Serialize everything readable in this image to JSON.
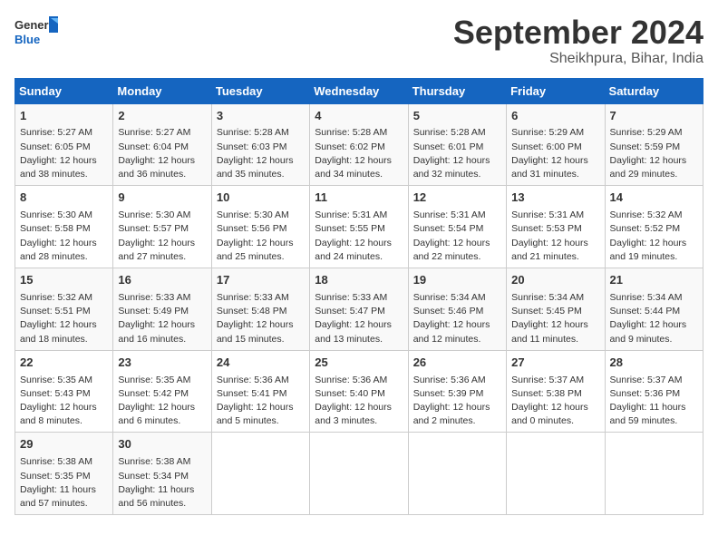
{
  "logo": {
    "line1": "General",
    "line2": "Blue"
  },
  "title": "September 2024",
  "location": "Sheikhpura, Bihar, India",
  "days_of_week": [
    "Sunday",
    "Monday",
    "Tuesday",
    "Wednesday",
    "Thursday",
    "Friday",
    "Saturday"
  ],
  "weeks": [
    [
      {
        "day": 1,
        "sunrise": "5:27 AM",
        "sunset": "6:05 PM",
        "daylight": "12 hours and 38 minutes."
      },
      {
        "day": 2,
        "sunrise": "5:27 AM",
        "sunset": "6:04 PM",
        "daylight": "12 hours and 36 minutes."
      },
      {
        "day": 3,
        "sunrise": "5:28 AM",
        "sunset": "6:03 PM",
        "daylight": "12 hours and 35 minutes."
      },
      {
        "day": 4,
        "sunrise": "5:28 AM",
        "sunset": "6:02 PM",
        "daylight": "12 hours and 34 minutes."
      },
      {
        "day": 5,
        "sunrise": "5:28 AM",
        "sunset": "6:01 PM",
        "daylight": "12 hours and 32 minutes."
      },
      {
        "day": 6,
        "sunrise": "5:29 AM",
        "sunset": "6:00 PM",
        "daylight": "12 hours and 31 minutes."
      },
      {
        "day": 7,
        "sunrise": "5:29 AM",
        "sunset": "5:59 PM",
        "daylight": "12 hours and 29 minutes."
      }
    ],
    [
      {
        "day": 8,
        "sunrise": "5:30 AM",
        "sunset": "5:58 PM",
        "daylight": "12 hours and 28 minutes."
      },
      {
        "day": 9,
        "sunrise": "5:30 AM",
        "sunset": "5:57 PM",
        "daylight": "12 hours and 27 minutes."
      },
      {
        "day": 10,
        "sunrise": "5:30 AM",
        "sunset": "5:56 PM",
        "daylight": "12 hours and 25 minutes."
      },
      {
        "day": 11,
        "sunrise": "5:31 AM",
        "sunset": "5:55 PM",
        "daylight": "12 hours and 24 minutes."
      },
      {
        "day": 12,
        "sunrise": "5:31 AM",
        "sunset": "5:54 PM",
        "daylight": "12 hours and 22 minutes."
      },
      {
        "day": 13,
        "sunrise": "5:31 AM",
        "sunset": "5:53 PM",
        "daylight": "12 hours and 21 minutes."
      },
      {
        "day": 14,
        "sunrise": "5:32 AM",
        "sunset": "5:52 PM",
        "daylight": "12 hours and 19 minutes."
      }
    ],
    [
      {
        "day": 15,
        "sunrise": "5:32 AM",
        "sunset": "5:51 PM",
        "daylight": "12 hours and 18 minutes."
      },
      {
        "day": 16,
        "sunrise": "5:33 AM",
        "sunset": "5:49 PM",
        "daylight": "12 hours and 16 minutes."
      },
      {
        "day": 17,
        "sunrise": "5:33 AM",
        "sunset": "5:48 PM",
        "daylight": "12 hours and 15 minutes."
      },
      {
        "day": 18,
        "sunrise": "5:33 AM",
        "sunset": "5:47 PM",
        "daylight": "12 hours and 13 minutes."
      },
      {
        "day": 19,
        "sunrise": "5:34 AM",
        "sunset": "5:46 PM",
        "daylight": "12 hours and 12 minutes."
      },
      {
        "day": 20,
        "sunrise": "5:34 AM",
        "sunset": "5:45 PM",
        "daylight": "12 hours and 11 minutes."
      },
      {
        "day": 21,
        "sunrise": "5:34 AM",
        "sunset": "5:44 PM",
        "daylight": "12 hours and 9 minutes."
      }
    ],
    [
      {
        "day": 22,
        "sunrise": "5:35 AM",
        "sunset": "5:43 PM",
        "daylight": "12 hours and 8 minutes."
      },
      {
        "day": 23,
        "sunrise": "5:35 AM",
        "sunset": "5:42 PM",
        "daylight": "12 hours and 6 minutes."
      },
      {
        "day": 24,
        "sunrise": "5:36 AM",
        "sunset": "5:41 PM",
        "daylight": "12 hours and 5 minutes."
      },
      {
        "day": 25,
        "sunrise": "5:36 AM",
        "sunset": "5:40 PM",
        "daylight": "12 hours and 3 minutes."
      },
      {
        "day": 26,
        "sunrise": "5:36 AM",
        "sunset": "5:39 PM",
        "daylight": "12 hours and 2 minutes."
      },
      {
        "day": 27,
        "sunrise": "5:37 AM",
        "sunset": "5:38 PM",
        "daylight": "12 hours and 0 minutes."
      },
      {
        "day": 28,
        "sunrise": "5:37 AM",
        "sunset": "5:36 PM",
        "daylight": "11 hours and 59 minutes."
      }
    ],
    [
      {
        "day": 29,
        "sunrise": "5:38 AM",
        "sunset": "5:35 PM",
        "daylight": "11 hours and 57 minutes."
      },
      {
        "day": 30,
        "sunrise": "5:38 AM",
        "sunset": "5:34 PM",
        "daylight": "11 hours and 56 minutes."
      },
      null,
      null,
      null,
      null,
      null
    ]
  ]
}
